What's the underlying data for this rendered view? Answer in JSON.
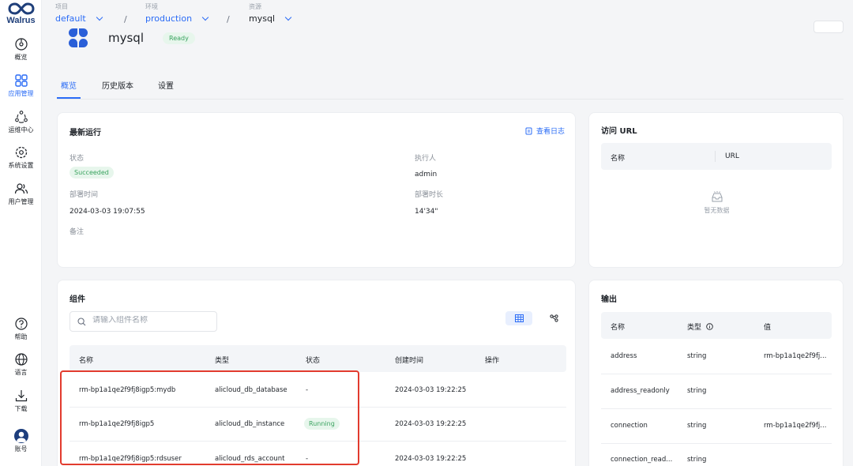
{
  "brand": {
    "name": "Walrus"
  },
  "sidebar": {
    "top_items": [
      {
        "label": "概览",
        "icon": "dashboard-icon"
      },
      {
        "label": "应用管理",
        "icon": "grid-icon"
      },
      {
        "label": "运维中心",
        "icon": "cluster-icon"
      },
      {
        "label": "系统设置",
        "icon": "settings-icon"
      },
      {
        "label": "用户管理",
        "icon": "users-icon"
      }
    ],
    "bottom_items": [
      {
        "label": "帮助",
        "icon": "help-icon"
      },
      {
        "label": "语言",
        "icon": "globe-icon"
      },
      {
        "label": "下载",
        "icon": "download-icon"
      },
      {
        "label": "账号",
        "icon": "account-icon"
      }
    ]
  },
  "breadcrumb": {
    "project": {
      "caption": "项目",
      "value": "default"
    },
    "environment": {
      "caption": "环境",
      "value": "production"
    },
    "resource": {
      "caption": "资源",
      "value": "mysql"
    },
    "separator": "/"
  },
  "header": {
    "title": "mysql",
    "status": "Ready"
  },
  "tabs": [
    {
      "label": "概览"
    },
    {
      "label": "历史版本"
    },
    {
      "label": "设置"
    }
  ],
  "latest_run": {
    "title": "最新运行",
    "view_logs": "查看日志",
    "status_label": "状态",
    "status_value": "Succeeded",
    "executor_label": "执行人",
    "executor_value": "admin",
    "deploy_time_label": "部署时间",
    "deploy_time_value": "2024-03-03 19:07:55",
    "duration_label": "部署时长",
    "duration_value": "14'34\"",
    "remark_label": "备注"
  },
  "access_url": {
    "title": "访问 URL",
    "columns": [
      "名称",
      "URL"
    ],
    "empty_text": "暂无数据"
  },
  "components": {
    "title": "组件",
    "search_placeholder": "请输入组件名称",
    "columns": [
      "名称",
      "类型",
      "状态",
      "创建时间",
      "操作"
    ],
    "rows": [
      {
        "name": "rm-bp1a1qe2f9fj8igp5:mydb",
        "type": "alicloud_db_database",
        "status": "-",
        "created": "2024-03-03 19:22:25"
      },
      {
        "name": "rm-bp1a1qe2f9fj8igp5",
        "type": "alicloud_db_instance",
        "status": "Running",
        "created": "2024-03-03 19:22:25"
      },
      {
        "name": "rm-bp1a1qe2f9fj8igp5:rdsuser",
        "type": "alicloud_rds_account",
        "status": "-",
        "created": "2024-03-03 19:22:25"
      }
    ]
  },
  "output": {
    "title": "输出",
    "columns": [
      "名称",
      "类型",
      "值"
    ],
    "rows": [
      {
        "name": "address",
        "type": "string",
        "value": "rm-bp1a1qe2f9fj..."
      },
      {
        "name": "address_readonly",
        "type": "string",
        "value": ""
      },
      {
        "name": "connection",
        "type": "string",
        "value": "rm-bp1a1qe2f9fj..."
      },
      {
        "name": "connection_read...",
        "type": "string",
        "value": ""
      }
    ]
  },
  "colors": {
    "accent": "#2b6cf6",
    "success": "#3aa35f",
    "highlight": "#e23b2e",
    "brand": "#1d3e7d"
  }
}
